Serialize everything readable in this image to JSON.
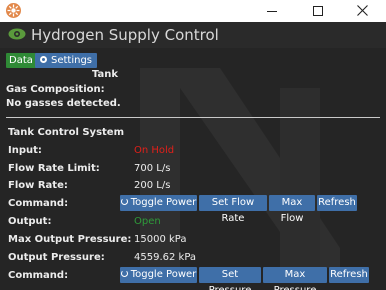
{
  "window": {
    "title": "Hydrogen Supply Control",
    "icon": "app-logo-icon",
    "controls": [
      "minimize-icon",
      "maximize-icon",
      "close-icon"
    ]
  },
  "tabs": {
    "data_label": "Data",
    "settings_label": "Settings"
  },
  "tank": {
    "section_title": "Tank",
    "gas_composition_label": "Gas Composition:",
    "gas_composition_value": "No gasses detected."
  },
  "control": {
    "section_title": "Tank Control System",
    "rows": [
      {
        "label": "Input:",
        "value": "On Hold"
      },
      {
        "label": "Flow Rate Limit:",
        "value": "700 L/s"
      },
      {
        "label": "Flow Rate:",
        "value": "200 L/s"
      },
      {
        "label": "Command:"
      },
      {
        "label": "Output:",
        "value": "Open"
      },
      {
        "label": "Max Output Pressure:",
        "value": "15000 kPa"
      },
      {
        "label": "Output Pressure:",
        "value": "4559.62 kPa"
      },
      {
        "label": "Command:"
      }
    ],
    "input_commands": [
      "Toggle Power",
      "Set Flow Rate",
      "Max Flow",
      "Refresh"
    ],
    "output_commands": [
      "Toggle Power",
      "Set Pressure",
      "Max Pressure",
      "Refresh"
    ]
  },
  "colors": {
    "background": "#252525",
    "tab_data": "#2f8a36",
    "button": "#3f6fa8",
    "status_hold": "#e0201a",
    "status_open": "#2f9a3a"
  }
}
